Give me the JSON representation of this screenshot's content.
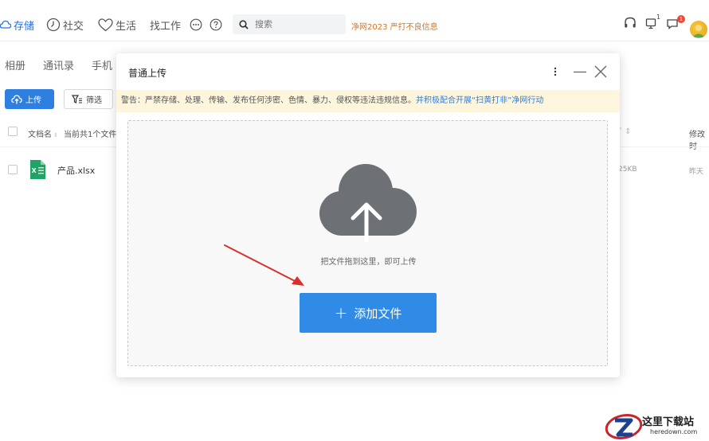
{
  "topnav": {
    "items": [
      "存储",
      "社交",
      "生活",
      "找工作"
    ],
    "search_placeholder": "搜索",
    "slogan": "净网2023 严打不良信息",
    "badge_small": "1",
    "badge_red": "1"
  },
  "subnav": {
    "items": [
      "相册",
      "通讯录",
      "手机"
    ]
  },
  "toolbar": {
    "upload_label": "上传",
    "filter_label": "筛选"
  },
  "table": {
    "col_name": "文档名",
    "col_count": "当前共1个文件",
    "col_modified": "修改时",
    "rows": [
      {
        "name": "产品.xlsx",
        "size": "25KB",
        "modified": "昨天"
      }
    ]
  },
  "dialog": {
    "title": "普通上传",
    "warning_text": "警告：严禁存储、处理、传输、发布任何涉密、色情、暴力、侵权等违法违规信息。",
    "warning_link": "并积极配合开展“扫黄打非”净网行动",
    "drop_hint": "把文件拖到这里，即可上传",
    "add_button": "添加文件"
  },
  "watermark": {
    "title": "这里下载站",
    "url": "heredown.com"
  },
  "colors": {
    "accent": "#2f7fe1",
    "slogan": "#d2772c",
    "warning_bg": "#fdf5dc",
    "arrow": "#d9302a",
    "cloud": "#6d7075"
  }
}
